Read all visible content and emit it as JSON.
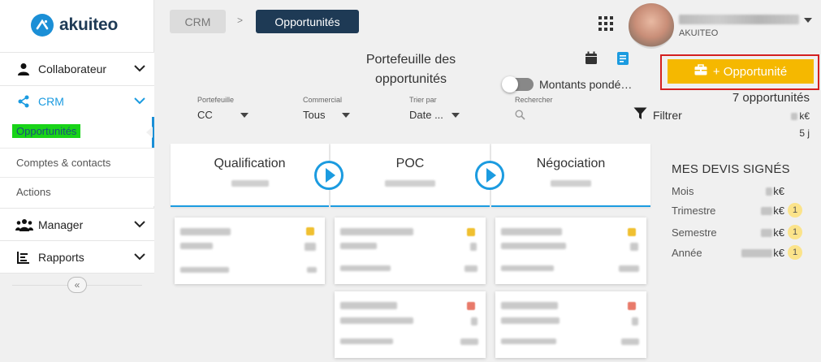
{
  "app": {
    "logo_text": "akuiteo"
  },
  "sidebar": {
    "items": [
      {
        "label": "Collaborateur",
        "icon": "user-icon"
      },
      {
        "label": "CRM",
        "icon": "share-icon"
      },
      {
        "label": "Manager",
        "icon": "team-icon"
      },
      {
        "label": "Rapports",
        "icon": "report-icon"
      }
    ],
    "crm_sub": [
      {
        "label": "Opportunités",
        "active": true
      },
      {
        "label": "Comptes & contacts"
      },
      {
        "label": "Actions"
      }
    ],
    "collapse_glyph": "«"
  },
  "breadcrumb": {
    "root": "CRM",
    "separator": ">",
    "current": "Opportunités"
  },
  "user": {
    "company": "AKUITEO"
  },
  "header": {
    "title_line1": "Portefeuille des",
    "title_line2": "opportunités",
    "toggle_label": "Montants pondé…",
    "add_button": "+ Opportunité",
    "accent_color": "#f5b800"
  },
  "filters": {
    "portefeuille": {
      "label": "Portefeuille",
      "value": "CC"
    },
    "commercial": {
      "label": "Commercial",
      "value": "Tous"
    },
    "trier_par": {
      "label": "Trier par",
      "value": "Date ..."
    },
    "rechercher": {
      "label": "Rechercher",
      "placeholder": ""
    },
    "filter_button": "Filtrer"
  },
  "summary": {
    "count": "7 opportunités",
    "amount_unit": "k€",
    "days": "5 j"
  },
  "stages": [
    {
      "name": "Qualification"
    },
    {
      "name": "POC"
    },
    {
      "name": "Négociation"
    }
  ],
  "devis": {
    "title": "MES DEVIS SIGNÉS",
    "rows": [
      {
        "label": "Mois",
        "unit": "k€",
        "badge": ""
      },
      {
        "label": "Trimestre",
        "unit": "k€",
        "badge": "1"
      },
      {
        "label": "Semestre",
        "unit": "k€",
        "badge": "1"
      },
      {
        "label": "Année",
        "unit": "k€",
        "badge": "1"
      }
    ]
  },
  "colors": {
    "brand_navy": "#1e3a55",
    "brand_blue": "#1b8fd6",
    "stage_blue": "#1b9be0",
    "highlight_green": "#18d418",
    "frame_red": "#d42020"
  }
}
